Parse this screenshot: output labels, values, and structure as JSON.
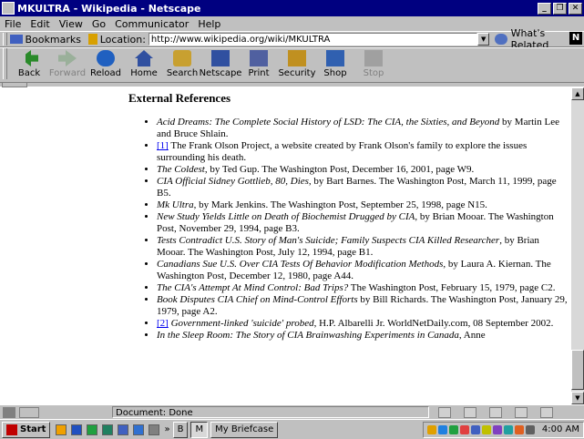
{
  "window": {
    "title": "MKULTRA - Wikipedia - Netscape",
    "minimize": "_",
    "maximize": "❐",
    "close": "✕"
  },
  "menu": [
    "File",
    "Edit",
    "View",
    "Go",
    "Communicator",
    "Help"
  ],
  "location": {
    "bookmarks": "Bookmarks",
    "label": "Location:",
    "url": "http://www.wikipedia.org/wiki/MKULTRA",
    "related": "What's Related"
  },
  "toolbar": {
    "buttons": [
      "Back",
      "Forward",
      "Reload",
      "Home",
      "Search",
      "Netscape",
      "Print",
      "Security",
      "Shop",
      "Stop"
    ]
  },
  "page": {
    "heading": "External References",
    "items": [
      {
        "pre": "",
        "title": "Acid Dreams: The Complete Social History of LSD: The CIA, the Sixties, and Beyond",
        "rest": " by Martin Lee and Bruce Shlain."
      },
      {
        "link": "[1]",
        "rest": " The Frank Olson Project, a website created by Frank Olson's family to explore the issues surrounding his death."
      },
      {
        "title": "The Coldest",
        "rest": ", by Ted Gup. The Washington Post, December 16, 2001, page W9."
      },
      {
        "title": "CIA Official Sidney Gottlieb, 80, Dies",
        "rest": ", by Bart Barnes. The Washington Post, March 11, 1999, page B5."
      },
      {
        "title": "Mk Ultra",
        "rest": ", by Mark Jenkins. The Washington Post, September 25, 1998, page N15."
      },
      {
        "title": "New Study Yields Little on Death of Biochemist Drugged by CIA",
        "rest": ", by Brian Mooar. The Washington Post, November 29, 1994, page B3."
      },
      {
        "title": "Tests Contradict U.S. Story of Man's Suicide; Family Suspects CIA Killed Researcher",
        "rest": ", by Brian Mooar. The Washington Post, July 12, 1994, page B1."
      },
      {
        "title": "Canadians Sue U.S. Over CIA Tests Of Behavior Modification Methods",
        "rest": ", by Laura A. Kiernan. The Washington Post, December 12, 1980, page A44."
      },
      {
        "title": "The CIA's Attempt At Mind Control: Bad Trips?",
        "rest": " The Washington Post, February 15, 1979, page C2."
      },
      {
        "title": "Book Disputes CIA Chief on Mind-Control Efforts",
        "rest": " by Bill Richards. The Washington Post, January 29, 1979, page A2."
      },
      {
        "link": "[2]",
        "title": "Government-linked 'suicide' probed",
        "rest": ", H.P. Albarelli Jr. WorldNetDaily.com, 08 September 2002."
      },
      {
        "title": "In the Sleep Room: The Story of CIA Brainwashing Experiments in Canada",
        "rest": ", Anne"
      }
    ]
  },
  "status": {
    "text": "Document: Done"
  },
  "taskbar": {
    "start": "Start",
    "chevron": "»",
    "tasks": [
      "B",
      "M"
    ],
    "briefcase": "My Briefcase",
    "clock": "4:00 AM"
  }
}
